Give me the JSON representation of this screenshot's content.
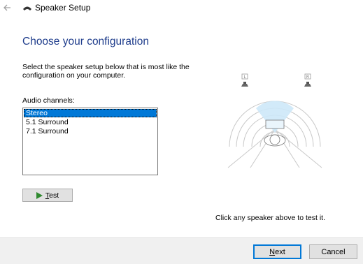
{
  "window": {
    "title": "Speaker Setup"
  },
  "page": {
    "heading": "Choose your configuration",
    "instructions": "Select the speaker setup below that is most like the configuration on your computer.",
    "channels_label": "Audio channels:",
    "channels": [
      "Stereo",
      "5.1 Surround",
      "7.1 Surround"
    ],
    "selected_channel": "Stereo",
    "test_label": "Test",
    "speaker_labels": {
      "left": "L",
      "right": "R"
    },
    "hint": "Click any speaker above to test it."
  },
  "footer": {
    "next_label": "Next",
    "cancel_label": "Cancel"
  },
  "colors": {
    "heading": "#1f3d8c",
    "selection": "#0078d7",
    "play": "#2f8a2f",
    "listener_highlight": "#cde8f8"
  }
}
